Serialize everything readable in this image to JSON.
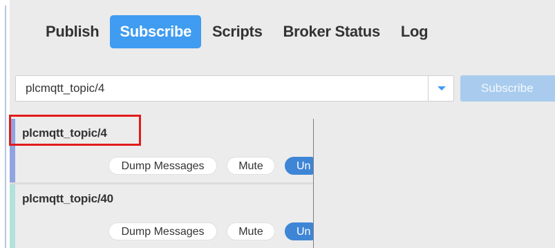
{
  "tabs": [
    {
      "label": "Publish",
      "active": false
    },
    {
      "label": "Subscribe",
      "active": true
    },
    {
      "label": "Scripts",
      "active": false
    },
    {
      "label": "Broker Status",
      "active": false
    },
    {
      "label": "Log",
      "active": false
    }
  ],
  "subscribe_bar": {
    "topic_value": "plcmqtt_topic/4",
    "subscribe_label": "Subscribe"
  },
  "subscriptions": [
    {
      "topic": "plcmqtt_topic/4",
      "accent_color": "#8fa4e0",
      "dump_label": "Dump Messages",
      "mute_label": "Mute",
      "unsubscribe_label": "Un"
    },
    {
      "topic": "plcmqtt_topic/40",
      "accent_color": "#b2e2da",
      "dump_label": "Dump Messages",
      "mute_label": "Mute",
      "unsubscribe_label": "Un"
    }
  ],
  "colors": {
    "accent": "#3f9cf1",
    "highlight": "#e21a1a"
  }
}
